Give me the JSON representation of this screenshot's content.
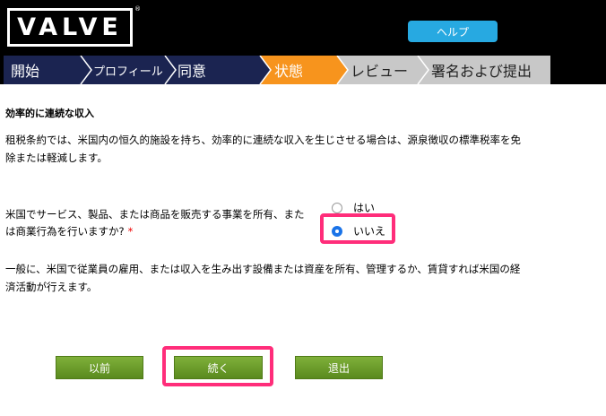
{
  "header": {
    "logo_text": "VALVE",
    "logo_mark": "®",
    "help_label": "ヘルプ"
  },
  "steps": [
    {
      "label": "開始",
      "state": "done"
    },
    {
      "label": "プロフィール",
      "state": "done"
    },
    {
      "label": "同意",
      "state": "done"
    },
    {
      "label": "状態",
      "state": "current"
    },
    {
      "label": "レビュー",
      "state": "pending"
    },
    {
      "label": "署名および提出",
      "state": "pending"
    }
  ],
  "colors": {
    "step_done": "#1b2451",
    "step_current": "#f7941d",
    "step_pending": "#c8c8c8",
    "help": "#27a9e1",
    "highlight": "#ff2d7a",
    "button": "#6a9c2a"
  },
  "section": {
    "title": "効率的に連続な収入",
    "intro": "租税条約では、米国内の恒久的施設を持ち、効率的に連続な収入を生じさせる場合は、源泉徴収の標準税率を免除または軽減します。"
  },
  "question": {
    "text": "米国でサービス、製品、または商品を販売する事業を所有、または商業行為を行いますか?",
    "required_mark": "*",
    "options": [
      {
        "label": "はい",
        "checked": false
      },
      {
        "label": "いいえ",
        "checked": true
      }
    ]
  },
  "explain": "一般に、米国で従業員の雇用、または収入を生み出す設備または資産を所有、管理するか、賃貸すれば米国の経済活動が行えます。",
  "buttons": {
    "prev": "以前",
    "continue": "続く",
    "exit": "退出"
  }
}
